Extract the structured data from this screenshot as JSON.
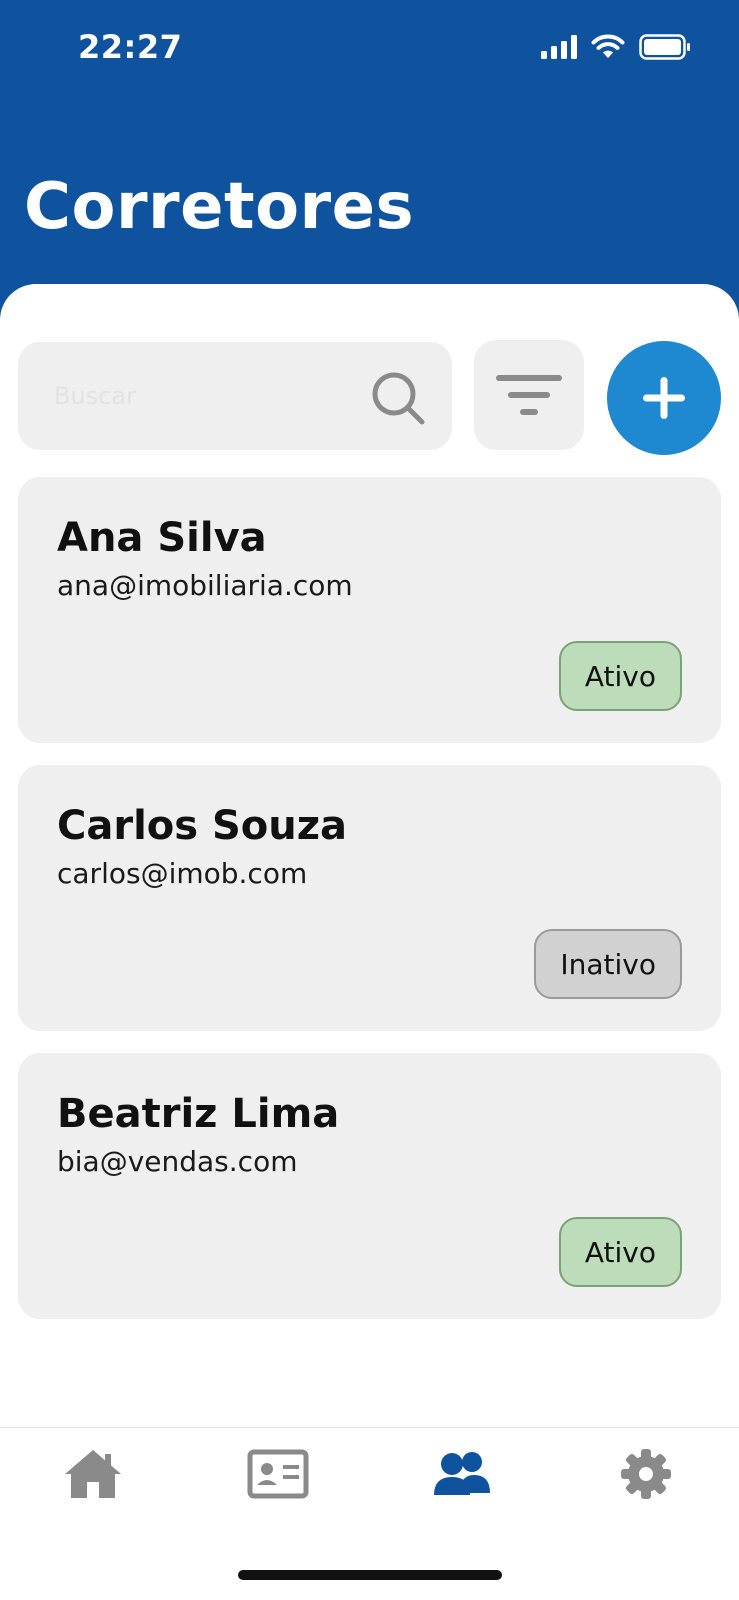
{
  "status_bar": {
    "time": "22:27"
  },
  "header": {
    "title": "Corretores"
  },
  "search": {
    "placeholder": "Buscar",
    "value": ""
  },
  "colors": {
    "brand": "#0f529d",
    "accent": "#1e88d0",
    "active": "#bcdcba",
    "inactive": "#d1d1d1",
    "nav_active": "#0f529d",
    "nav_inactive": "#8a8a8a"
  },
  "brokers": [
    {
      "name": "Ana Silva",
      "email": "ana@imobiliaria.com",
      "status": "Ativo"
    },
    {
      "name": "Carlos Souza",
      "email": "carlos@imob.com",
      "status": "Inativo"
    },
    {
      "name": "Beatriz Lima",
      "email": "bia@vendas.com",
      "status": "Ativo"
    }
  ],
  "nav": [
    {
      "icon": "home-icon"
    },
    {
      "icon": "contact-card-icon"
    },
    {
      "icon": "users-icon",
      "active": true
    },
    {
      "icon": "gear-icon"
    }
  ]
}
